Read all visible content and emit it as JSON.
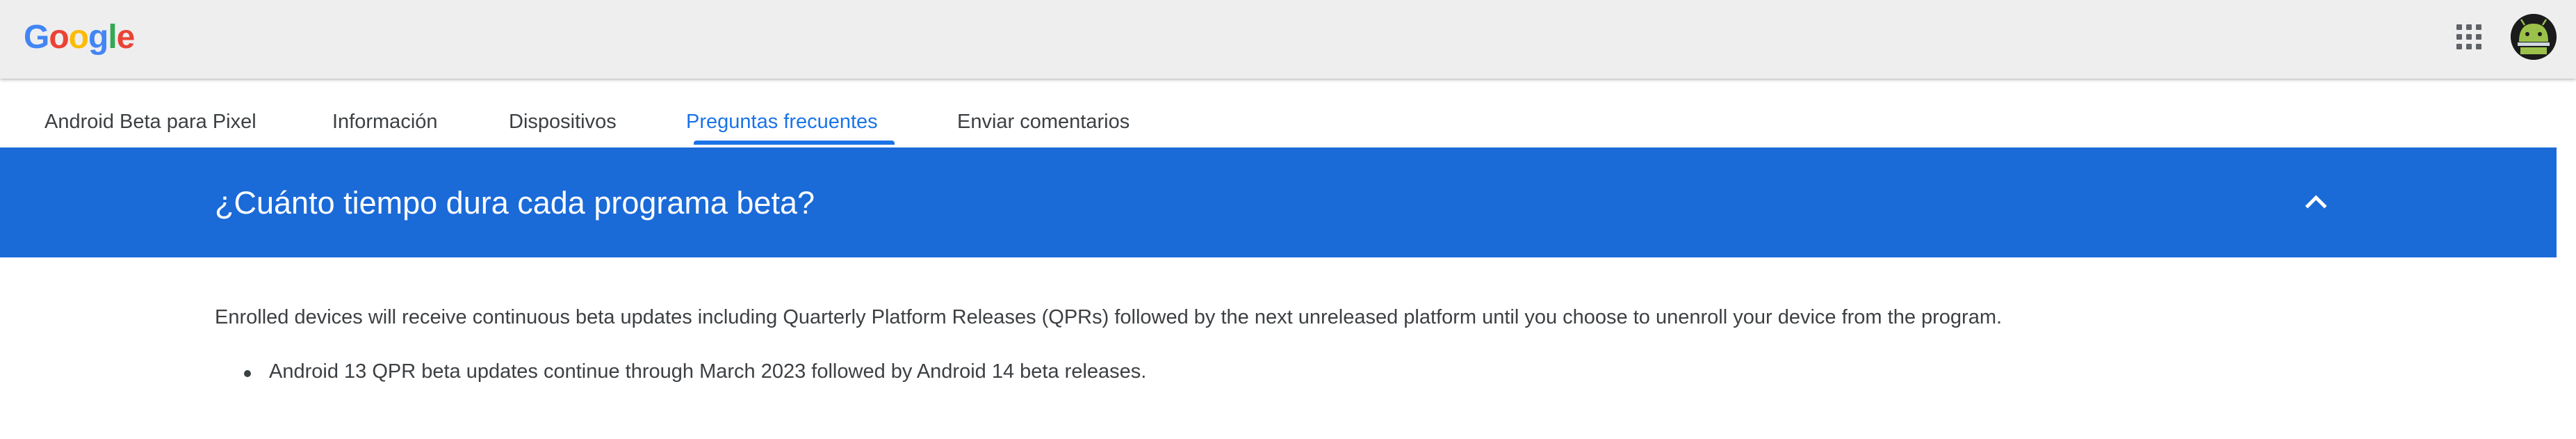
{
  "header": {
    "logo_letters": [
      {
        "char": "G",
        "color": "#4285F4"
      },
      {
        "char": "o",
        "color": "#EA4335"
      },
      {
        "char": "o",
        "color": "#FBBC05"
      },
      {
        "char": "g",
        "color": "#4285F4"
      },
      {
        "char": "l",
        "color": "#34A853"
      },
      {
        "char": "e",
        "color": "#EA4335"
      }
    ],
    "apps_icon": "apps-grid-icon",
    "avatar_icon": "android-avatar-icon"
  },
  "tabs": [
    {
      "label": "Android Beta para Pixel",
      "active": false
    },
    {
      "label": "Información",
      "active": false
    },
    {
      "label": "Dispositivos",
      "active": false
    },
    {
      "label": "Preguntas frecuentes",
      "active": true
    },
    {
      "label": "Enviar comentarios",
      "active": false
    }
  ],
  "faq": {
    "question": "¿Cuánto tiempo dura cada programa beta?",
    "expanded": true,
    "toggle_icon": "chevron-up-icon",
    "answer": "Enrolled devices will receive continuous beta updates including Quarterly Platform Releases (QPRs) followed by the next unreleased platform until you choose to unenroll your device from the program.",
    "bullets": [
      "Android 13 QPR beta updates continue through March 2023 followed by Android 14 beta releases."
    ]
  },
  "colors": {
    "accent": "#1a73e8",
    "faq_header_bg": "#1a6ad8",
    "topbar_bg": "#eeeeee",
    "text": "#3c4043"
  }
}
